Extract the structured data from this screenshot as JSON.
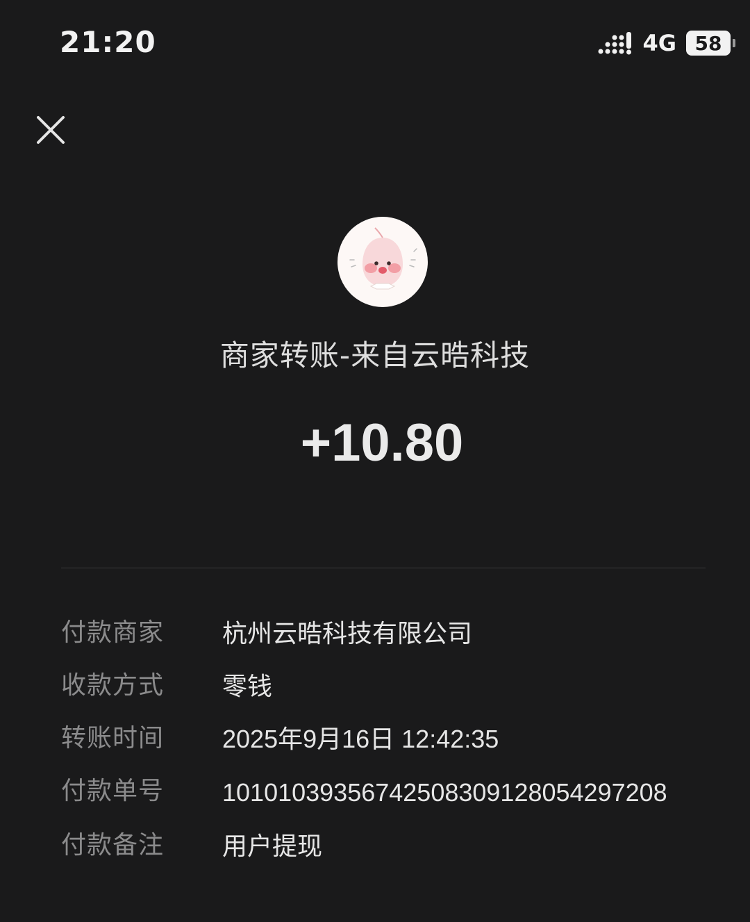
{
  "status_bar": {
    "time": "21:20",
    "network": "4G",
    "battery": "58",
    "icons": [
      "signal-icon",
      "battery-icon"
    ]
  },
  "header": {
    "close_icon": "close-icon"
  },
  "merchant": {
    "title": "商家转账-来自云晧科技",
    "amount": "+10.80",
    "avatar_icon": "peach-character-avatar"
  },
  "details": [
    {
      "label": "付款商家",
      "value": "杭州云晧科技有限公司"
    },
    {
      "label": "收款方式",
      "value": "零钱"
    },
    {
      "label": "转账时间",
      "value": "2025年9月16日 12:42:35"
    },
    {
      "label": "付款单号",
      "value": "10101039356742508309128054297208"
    },
    {
      "label": "付款备注",
      "value": "用户提现"
    }
  ],
  "colors": {
    "background": "#1a1a1b",
    "label": "#8b8b8c",
    "value": "#e6e6e6",
    "divider": "#3a3a3b"
  }
}
